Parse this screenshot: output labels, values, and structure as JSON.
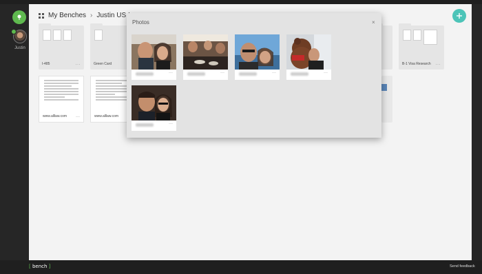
{
  "rail": {
    "user_name": "Justin"
  },
  "breadcrumb": {
    "root": "My Benches",
    "separator": "›",
    "current": "Justin US Imm"
  },
  "cards": [
    {
      "label": "I-485",
      "menu": "···"
    },
    {
      "label": "Green Card",
      "menu": "···"
    },
    {
      "label": "B-1 Visa Research",
      "menu": "···"
    }
  ],
  "docs": [
    {
      "label": "www.alllaw.com",
      "menu": "···"
    },
    {
      "label": "www.alllaw.com",
      "menu": "···"
    }
  ],
  "modal": {
    "title": "Photos",
    "close": "×",
    "photo_menu": "···"
  },
  "footer": {
    "logo": "bench",
    "feedback": "Send feedback"
  },
  "colors": {
    "accent_green": "#5fb94f",
    "accent_teal": "#4cc4b8"
  }
}
